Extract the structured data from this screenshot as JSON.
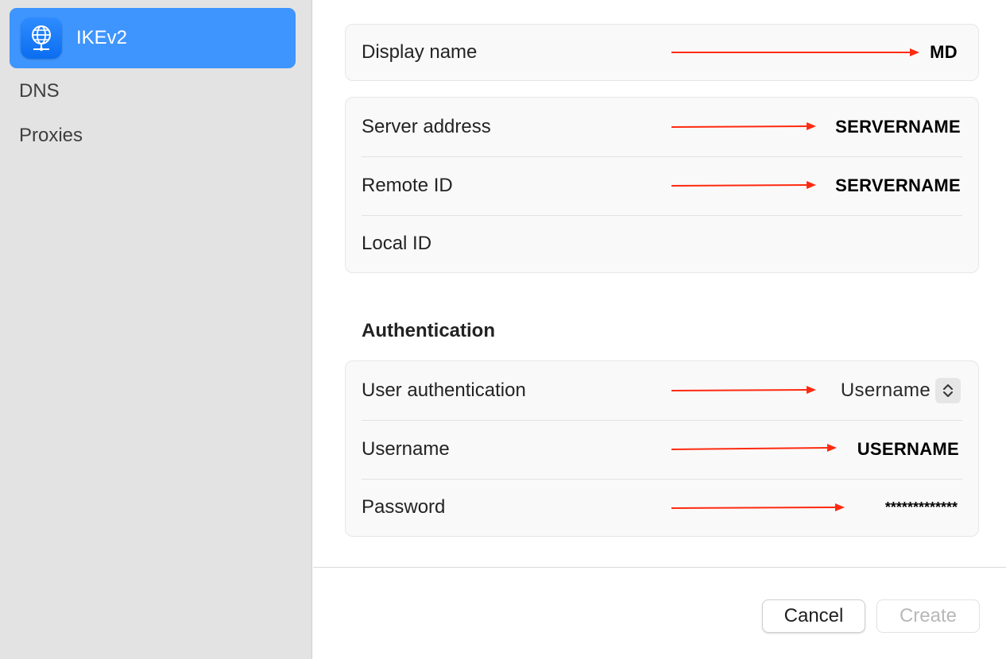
{
  "sidebar": {
    "items": [
      {
        "label": "IKEv2",
        "icon": "globe-network-icon",
        "selected": true
      },
      {
        "label": "DNS"
      },
      {
        "label": "Proxies"
      }
    ]
  },
  "general": {
    "display_name": {
      "label": "Display name",
      "value": "MD"
    }
  },
  "server": {
    "server_address": {
      "label": "Server address",
      "value": "SERVERNAME"
    },
    "remote_id": {
      "label": "Remote ID",
      "value": "SERVERNAME"
    },
    "local_id": {
      "label": "Local ID",
      "value": ""
    }
  },
  "authentication": {
    "title": "Authentication",
    "user_authentication": {
      "label": "User authentication",
      "value": "Username"
    },
    "username": {
      "label": "Username",
      "value": "USERNAME"
    },
    "password": {
      "label": "Password",
      "value": "*************"
    }
  },
  "footer": {
    "cancel_label": "Cancel",
    "create_label": "Create"
  },
  "colors": {
    "accent": "#3e95fe",
    "annotation_arrow": "#ff2a10"
  }
}
